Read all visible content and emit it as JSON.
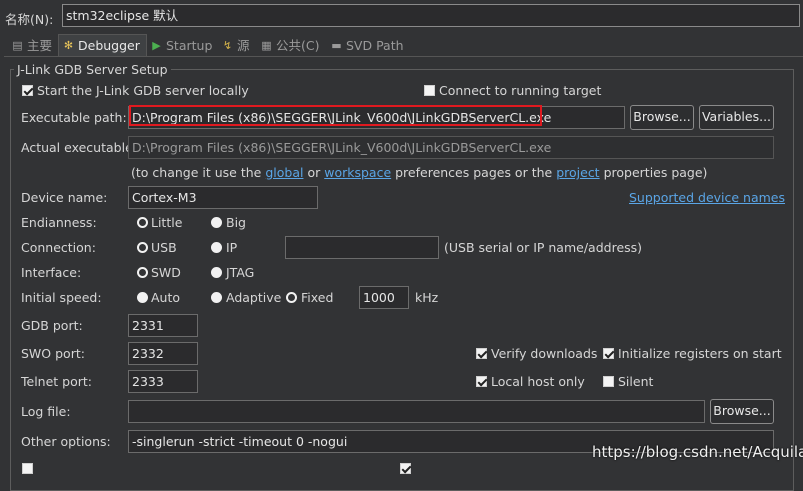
{
  "name_label": "名称(N):",
  "name_value": "stm32eclipse 默认",
  "tabs": [
    {
      "label": "主要",
      "icon": "document-icon"
    },
    {
      "label": "Debugger",
      "icon": "bug-icon"
    },
    {
      "label": "Startup",
      "icon": "play-icon"
    },
    {
      "label": "源",
      "icon": "source-icon"
    },
    {
      "label": "公共(C)",
      "icon": "common-icon"
    },
    {
      "label": "SVD Path",
      "icon": "svd-icon"
    }
  ],
  "group_title": "J-Link GDB Server Setup",
  "start_server_label": "Start the J-Link GDB server locally",
  "connect_running_label": "Connect to running target",
  "executable_label": "Executable path:",
  "executable_value": "D:\\Program Files (x86)\\SEGGER\\JLink_V600d\\JLinkGDBServerCL.exe",
  "browse_label": "Browse...",
  "variables_label": "Variables...",
  "actual_label": "Actual executable:",
  "actual_value": "D:\\Program Files (x86)\\SEGGER\\JLink_V600d\\JLinkGDBServerCL.exe",
  "hint": {
    "prefix": "(to change it use the",
    "global": "global",
    "or": "or",
    "workspace": "workspace",
    "middle": "preferences pages or the",
    "project": "project",
    "suffix": "properties page)"
  },
  "device_label": "Device name:",
  "device_value": "Cortex-M3",
  "supported_devices": "Supported device names",
  "endianness_label": "Endianness:",
  "little": "Little",
  "big": "Big",
  "connection_label": "Connection:",
  "usb": "USB",
  "ip": "IP",
  "connection_hint": "(USB serial or IP name/address)",
  "interface_label": "Interface:",
  "swd": "SWD",
  "jtag": "JTAG",
  "speed_label": "Initial speed:",
  "auto": "Auto",
  "adaptive": "Adaptive",
  "fixed": "Fixed",
  "speed_value": "1000",
  "khz": "kHz",
  "gdb_port_label": "GDB port:",
  "gdb_port_value": "2331",
  "swo_port_label": "SWO port:",
  "swo_port_value": "2332",
  "telnet_port_label": "Telnet port:",
  "telnet_port_value": "2333",
  "verify_downloads": "Verify downloads",
  "init_registers": "Initialize registers on start",
  "local_host_only": "Local host only",
  "silent": "Silent",
  "log_label": "Log file:",
  "log_value": "",
  "log_browse": "Browse...",
  "other_label": "Other options:",
  "other_value": "-singlerun -strict -timeout 0 -nogui",
  "watermark": "https://blog.csdn.net/Acquila",
  "colors": {
    "highlight_box": "#e0191f",
    "link": "#5aa5e6",
    "background": "#323335"
  }
}
